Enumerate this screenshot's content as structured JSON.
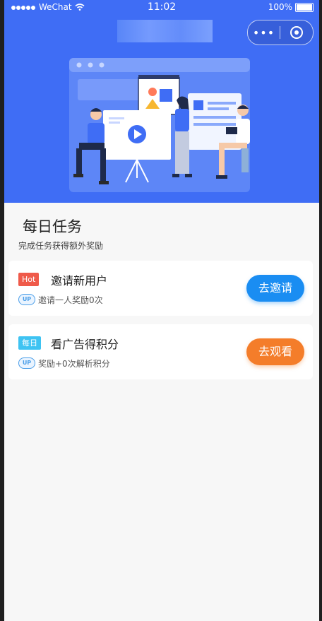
{
  "status_bar": {
    "carrier": "WeChat",
    "time": "11:02",
    "battery": "100%"
  },
  "capsule": {
    "more": "•••"
  },
  "section": {
    "title": "每日任务",
    "subtitle": "完成任务获得额外奖励"
  },
  "tasks": [
    {
      "tag": "Hot",
      "title": "邀请新用户",
      "badge": "UP",
      "desc": "邀请一人奖励0次",
      "button": "去邀请",
      "button_color": "#1a8df2"
    },
    {
      "tag": "每日",
      "title": "看广告得积分",
      "badge": "UP",
      "desc": "奖励+0次解析积分",
      "button": "去观看",
      "button_color": "#f47d2a"
    }
  ],
  "colors": {
    "hero": "#3f6df5",
    "hot_tag": "#ef5a4a",
    "daily_tag": "#3ec3f2"
  }
}
